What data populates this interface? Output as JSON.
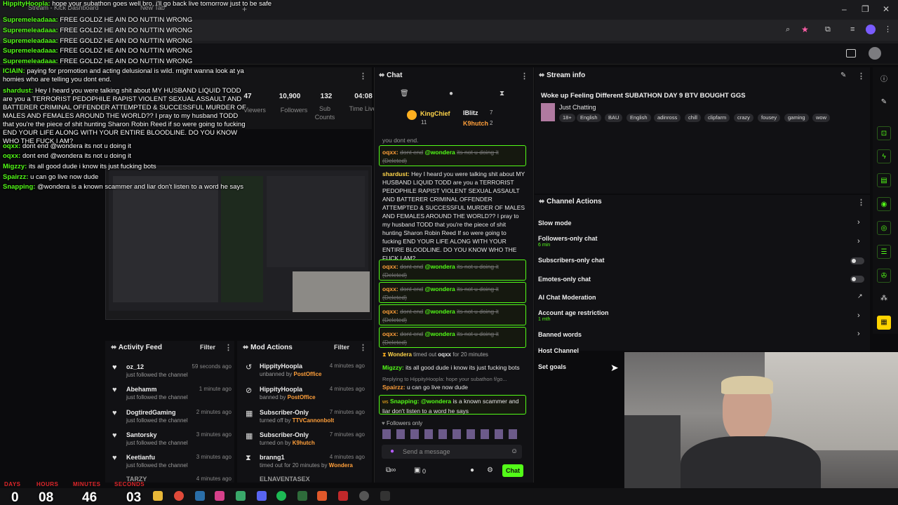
{
  "browser": {
    "tabs": [
      "Stream - Kick Dashboard",
      "New Tab"
    ],
    "new_tab": "+"
  },
  "stats": {
    "items": [
      {
        "value": "47",
        "label": "Viewers"
      },
      {
        "value": "10,900",
        "label": "Followers"
      },
      {
        "value": "132",
        "label": "Sub Counts"
      },
      {
        "value": "04:08",
        "label": "Time Live"
      }
    ]
  },
  "overlay_chat": [
    {
      "name": "HippityHoopla:",
      "text": "hope your subathon goes well bro, i'll go back live tomorrow just to be safe"
    },
    {
      "name": "Supremeleadaaa:",
      "text": "FREE GOLDZ HE AIN DO NUTTIN WRONG"
    },
    {
      "name": "Supremeleadaaa:",
      "text": "FREE GOLDZ HE AIN DO NUTTIN WRONG"
    },
    {
      "name": "Supremeleadaaa:",
      "text": "FREE GOLDZ HE AIN DO NUTTIN WRONG"
    },
    {
      "name": "Supremeleadaaa:",
      "text": "FREE GOLDZ HE AIN DO NUTTIN WRONG"
    },
    {
      "name": "Supremeleadaaa:",
      "text": "FREE GOLDZ HE AIN DO NUTTIN WRONG"
    },
    {
      "name": "ICIAIN:",
      "text": "paying for promotion and acting delusional is wild. might wanna look at ya homies who are telling you dont end."
    },
    {
      "name": "shardust:",
      "text": "Hey I heard you were talking shit about MY HUSBAND LIQUID TODD are you a TERRORIST PEDOPHILE RAPIST VIOLENT SEXUAL ASSAULT AND BATTERER CRIMINAL OFFENDER ATTEMPTED & SUCCESSFUL MURDER OF MALES AND FEMALES AROUND THE WORLD?? I pray to my husband TODD that you're the piece of shit hunting Sharon Robin Reed if so were going to fucking END YOUR LIFE ALONG WITH YOUR ENTIRE BLOODLINE. DO YOU KNOW WHO THE FUCK I AM?"
    },
    {
      "name": "oqxx:",
      "text": "dont end @wondera its not u doing it"
    },
    {
      "name": "oqxx:",
      "text": "dont end @wondera its not u doing it"
    },
    {
      "name": "Migzzy:",
      "text": "its all good dude i know its just fucking bots"
    },
    {
      "name": "Spairzz:",
      "text": "u can go live now dude"
    },
    {
      "name": "Snapping:",
      "text": "@wondera is a known scammer and liar don't listen to a word he says"
    }
  ],
  "chat": {
    "title": "Chat",
    "leaderboard": [
      {
        "name": "KingChief",
        "count": "11"
      },
      {
        "name": "IBlitz",
        "count": "7"
      },
      {
        "name": "K9hutch",
        "count": "2"
      }
    ],
    "partial_top": "you dont end.",
    "messages": [
      {
        "name": "oqxx:",
        "mention": "@wondera",
        "text": "dont end",
        "rest": "its not u doing it",
        "deleted": "(Deleted)"
      },
      {
        "name": "shardust:",
        "text": "Hey I heard you were talking shit about MY HUSBAND LIQUID TODD are you a TERRORIST PEDOPHILE RAPIST VIOLENT SEXUAL ASSAULT AND BATTERER CRIMINAL OFFENDER ATTEMPTED & SUCCESSFUL MURDER OF MALES AND FEMALES AROUND THE WORLD?? I pray to my husband TODD that you're the piece of shit hunting Sharon Robin Reed If so were going to fucking END YOUR LIFE ALONG WITH YOUR ENTIRE BLOODLINE. DO YOU KNOW WHO THE FUCK I AM?"
      },
      {
        "name": "oqxx:",
        "mention": "@wondera",
        "text": "dont end",
        "rest": "its not u doing it",
        "deleted": "(Deleted)"
      },
      {
        "name": "oqxx:",
        "mention": "@wondera",
        "text": "dont end",
        "rest": "its not u doing it",
        "deleted": "(Deleted)"
      },
      {
        "name": "oqxx:",
        "mention": "@wondera",
        "text": "dont end",
        "rest": "its not u doing it",
        "deleted": "(Deleted)"
      },
      {
        "name": "oqxx:",
        "mention": "@wondera",
        "text": "dont end",
        "rest": "its not u doing it",
        "deleted": "(Deleted)"
      }
    ],
    "timeout": {
      "mod": "Wondera",
      "text": "timed out",
      "user": "oqxx",
      "dur": "for 20 minutes"
    },
    "migzzy": {
      "name": "Migzzy:",
      "text": "its all good dude i know its just fucking bots"
    },
    "reply": "Replying to HippityHoopla: hope your subathon f/go...",
    "spairzz": {
      "name": "Spairzz:",
      "text": "u can go live now dude"
    },
    "snapping": {
      "badge": "ws",
      "name": "Snapping:",
      "mention": "@wondera",
      "text": "is a known scammer and liar don't listen to a word he says"
    },
    "followers_only": "Followers only",
    "input_placeholder": "Send a message",
    "points": "0",
    "send_label": "Chat"
  },
  "activity": {
    "title": "Activity Feed",
    "filter": "Filter",
    "items": [
      {
        "name": "oz_12",
        "sub": "just followed the channel",
        "time": "59 seconds ago"
      },
      {
        "name": "Abehamm",
        "sub": "just followed the channel",
        "time": "1 minute ago"
      },
      {
        "name": "DogtiredGaming",
        "sub": "just followed the channel",
        "time": "2 minutes ago"
      },
      {
        "name": "Santorsky",
        "sub": "just followed the channel",
        "time": "3 minutes ago"
      },
      {
        "name": "Keetianfu",
        "sub": "just followed the channel",
        "time": "3 minutes ago"
      },
      {
        "name": "TARZY",
        "sub": "",
        "time": "4 minutes ago"
      }
    ]
  },
  "mod": {
    "title": "Mod Actions",
    "filter": "Filter",
    "items": [
      {
        "name": "HippityHoopla",
        "sub": "unbanned by",
        "by": "PostOffice",
        "time": "4 minutes ago",
        "icon": "↺"
      },
      {
        "name": "HippityHoopla",
        "sub": "banned by",
        "by": "PostOffice",
        "time": "4 minutes ago",
        "icon": "⊘"
      },
      {
        "name": "Subscriber-Only",
        "sub": "turned off by",
        "by": "TTVCannonbolt",
        "time": "7 minutes ago",
        "icon": "▦"
      },
      {
        "name": "Subscriber-Only",
        "sub": "turned on by",
        "by": "K9hutch",
        "time": "7 minutes ago",
        "icon": "▦"
      },
      {
        "name": "branng1",
        "sub": "timed out for 20 minutes by",
        "by": "Wondera",
        "time": "4 minutes ago",
        "icon": "⧗"
      },
      {
        "name": "ELNAVENTASEX",
        "sub": "",
        "by": "",
        "time": "",
        "icon": ""
      }
    ]
  },
  "stream_info": {
    "title": "Stream info",
    "stream_title": "Woke up Feeling Different SUBATHON DAY 9 BTV BOUGHT GGS",
    "category": "Just Chatting",
    "tags": [
      "18+",
      "English",
      "BAU",
      "English",
      "adinross",
      "chill",
      "clipfarm",
      "crazy",
      "fousey",
      "gaming",
      "wow"
    ]
  },
  "channel_actions": {
    "title": "Channel Actions",
    "rows": [
      {
        "label": "Slow mode",
        "sub": "",
        "control": "chevron"
      },
      {
        "label": "Followers-only chat",
        "sub": "6 min",
        "control": "chevron"
      },
      {
        "label": "Subscribers-only chat",
        "sub": "",
        "control": "toggle"
      },
      {
        "label": "Emotes-only chat",
        "sub": "",
        "control": "toggle"
      },
      {
        "label": "AI Chat Moderation",
        "sub": "",
        "control": "external"
      },
      {
        "label": "Account age restriction",
        "sub": "1 mth",
        "control": "chevron"
      },
      {
        "label": "Banned words",
        "sub": "",
        "control": "chevron"
      },
      {
        "label": "Host Channel",
        "sub": "",
        "control": "none"
      },
      {
        "label": "Set goals",
        "sub": "",
        "control": "none"
      }
    ]
  },
  "countdown": {
    "labels": [
      "DAYS",
      "HOURS",
      "MINUTES",
      "SECONDS"
    ],
    "values": [
      "0",
      "08",
      "46",
      "03"
    ]
  },
  "colors": {
    "accent": "#53fc18",
    "bg": "#111114",
    "countdown_label": "#e0262a"
  }
}
